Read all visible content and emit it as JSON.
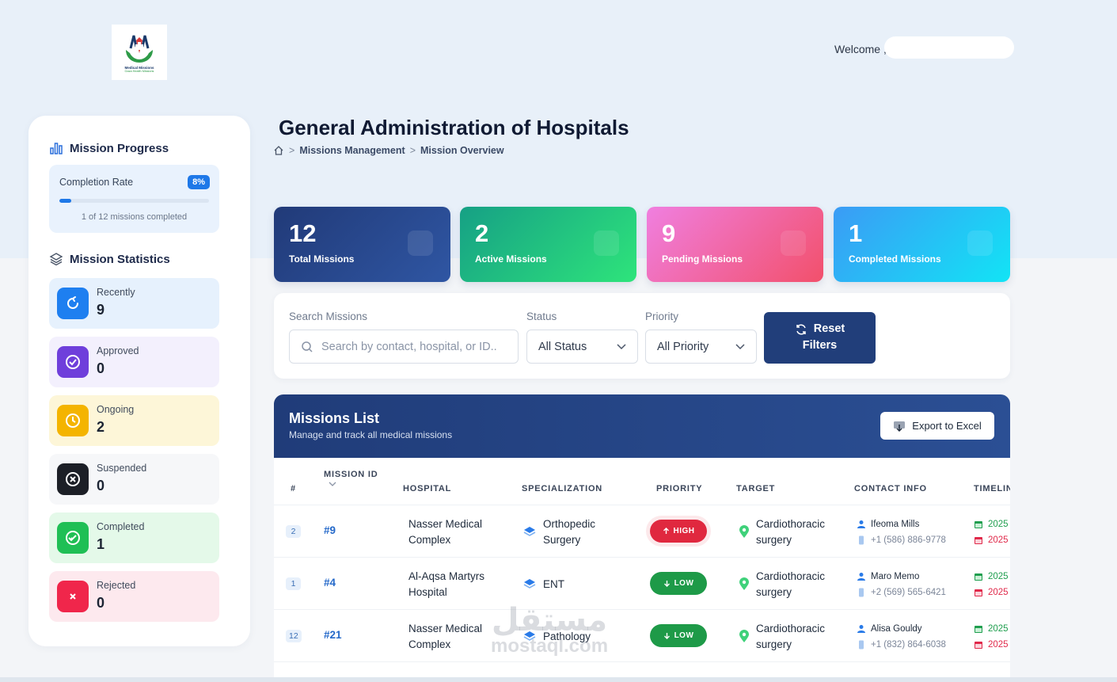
{
  "header": {
    "logo_line1": "Medical Missions",
    "logo_line2": "Gaza Health Missions",
    "welcome": "Welcome ,"
  },
  "sidebar": {
    "progress_title": "Mission Progress",
    "completion_label": "Completion Rate",
    "completion_pct": "8%",
    "completion_fraction": 0.08,
    "completion_sub": "1 of 12 missions completed",
    "stats_title": "Mission Statistics",
    "stats": [
      {
        "name": "Recently",
        "value": "9",
        "bg": "#e6f1fd",
        "box": "#1e7ff0"
      },
      {
        "name": "Approved",
        "value": "0",
        "bg": "#f3f0fd",
        "box": "#6f3fdb"
      },
      {
        "name": "Ongoing",
        "value": "2",
        "bg": "#fdf6d8",
        "box": "#f4b400"
      },
      {
        "name": "Suspended",
        "value": "0",
        "bg": "#f6f7f9",
        "box": "#1c1f26"
      },
      {
        "name": "Completed",
        "value": "1",
        "bg": "#e4f9e9",
        "box": "#1fbf55"
      },
      {
        "name": "Rejected",
        "value": "0",
        "bg": "#fde9ee",
        "box": "#f0264b"
      }
    ]
  },
  "page": {
    "title": "General Administration of Hospitals",
    "breadcrumb": [
      "Missions Management",
      "Mission Overview"
    ]
  },
  "cards": [
    {
      "num": "12",
      "label": "Total Missions",
      "grad": "linear-gradient(135deg,#213a78,#2f56a3)"
    },
    {
      "num": "2",
      "label": "Active Missions",
      "grad": "linear-gradient(135deg,#16a085,#2ee47b)"
    },
    {
      "num": "9",
      "label": "Pending Missions",
      "grad": "linear-gradient(135deg,#f07fe0,#f2506b)"
    },
    {
      "num": "1",
      "label": "Completed Missions",
      "grad": "linear-gradient(135deg,#3b9bf5,#12e4f5)"
    }
  ],
  "filters": {
    "search_label": "Search Missions",
    "search_placeholder": "Search by contact, hospital, or ID..",
    "status_label": "Status",
    "status_value": "All Status",
    "priority_label": "Priority",
    "priority_value": "All Priority",
    "reset_line1": "Reset",
    "reset_line2": "Filters"
  },
  "missions": {
    "title": "Missions List",
    "subtitle": "Manage and track all medical missions",
    "export_label": "Export to Excel",
    "columns": [
      "#",
      "MISSION ID",
      "HOSPITAL",
      "SPECIALIZATION",
      "PRIORITY",
      "TARGET",
      "CONTACT INFO",
      "TIMELIN"
    ],
    "rows": [
      {
        "idx": "2",
        "id": "#9",
        "hospital": "Nasser Medical Complex",
        "spec": "Orthopedic Surgery",
        "priority": "HIGH",
        "pcolor": "#e0283f",
        "target": "Cardiothoracic surgery",
        "contact": "Ifeoma Mills",
        "phone": "+1 (586) 886-9778",
        "start": "2025",
        "end": "2025"
      },
      {
        "idx": "1",
        "id": "#4",
        "hospital": "Al-Aqsa Martyrs Hospital",
        "spec": "ENT",
        "priority": "LOW",
        "pcolor": "#1e9a48",
        "target": "Cardiothoracic surgery",
        "contact": "Maro Memo",
        "phone": "+2 (569) 565-6421",
        "start": "2025",
        "end": "2025"
      },
      {
        "idx": "12",
        "id": "#21",
        "hospital": "Nasser Medical Complex",
        "spec": "Pathology",
        "priority": "LOW",
        "pcolor": "#1e9a48",
        "target": "Cardiothoracic surgery",
        "contact": "Alisa Gouldy",
        "phone": "+1 (832) 864-6038",
        "start": "2025",
        "end": "2025"
      }
    ]
  },
  "watermark": {
    "line1": "مستقل",
    "line2": "mostaql.com"
  }
}
